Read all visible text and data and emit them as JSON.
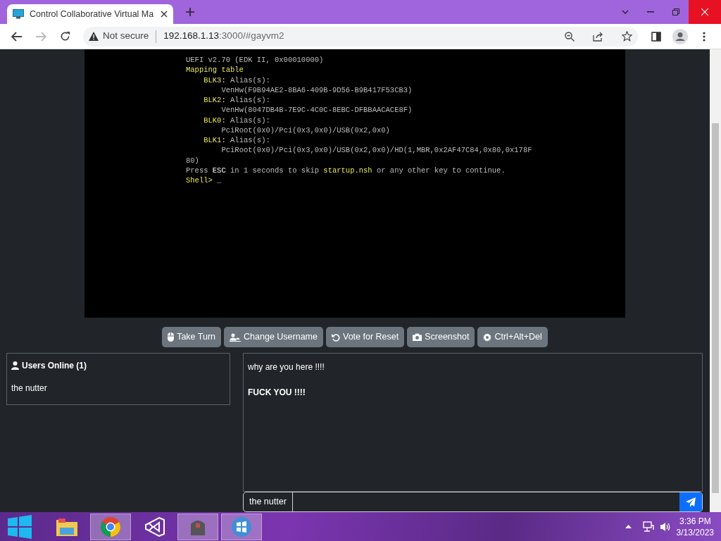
{
  "browser": {
    "tab_title": "Control Collaborative Virtual Ma",
    "security_label": "Not secure",
    "url_host": "192.168.1.13",
    "url_rest": ":3000/#gayvm2",
    "forward_disabled": true
  },
  "console": {
    "lines": [
      {
        "kind": "text",
        "segments": [
          {
            "text": "UEFI v2.70 (EDK II, 0x00010000)",
            "highlight": false
          }
        ]
      },
      {
        "kind": "text",
        "segments": [
          {
            "text": "Mapping table",
            "highlight": true
          }
        ]
      },
      {
        "kind": "alias",
        "segments": [
          {
            "text": "BLK3:",
            "highlight": true
          },
          {
            "text": " Alias(s):",
            "highlight": false
          }
        ]
      },
      {
        "kind": "path",
        "segments": [
          {
            "text": "VenHw(F9B94AE2-8BA6-409B-9D56-B9B417F53CB3)",
            "highlight": false
          }
        ]
      },
      {
        "kind": "alias",
        "segments": [
          {
            "text": "BLK2:",
            "highlight": true
          },
          {
            "text": " Alias(s):",
            "highlight": false
          }
        ]
      },
      {
        "kind": "path",
        "segments": [
          {
            "text": "VenHw(8047DB4B-7E9C-4C0C-8EBC-DFBBAACACE8F)",
            "highlight": false
          }
        ]
      },
      {
        "kind": "alias",
        "segments": [
          {
            "text": "BLK0:",
            "highlight": true
          },
          {
            "text": " Alias(s):",
            "highlight": false
          }
        ]
      },
      {
        "kind": "path",
        "segments": [
          {
            "text": "PciRoot(0x0)/Pci(0x3,0x0)/USB(0x2,0x0)",
            "highlight": false
          }
        ]
      },
      {
        "kind": "alias",
        "segments": [
          {
            "text": "BLK1:",
            "highlight": true
          },
          {
            "text": " Alias(s):",
            "highlight": false
          }
        ]
      },
      {
        "kind": "path",
        "segments": [
          {
            "text": "PciRoot(0x0)/Pci(0x3,0x0)/USB(0x2,0x0)/HD(1,MBR,0x2AF47C84,0x80,0x178F",
            "highlight": false
          }
        ]
      },
      {
        "kind": "text",
        "segments": [
          {
            "text": "80)",
            "highlight": false
          }
        ]
      },
      {
        "kind": "text",
        "segments": [
          {
            "text": "Press ",
            "highlight": false
          },
          {
            "text": "ESC",
            "highlight": false,
            "bright": true
          },
          {
            "text": " in 1 seconds to skip ",
            "highlight": false
          },
          {
            "text": "startup.nsh",
            "highlight": true
          },
          {
            "text": " or any other key to continue.",
            "highlight": false
          }
        ]
      },
      {
        "kind": "text",
        "segments": [
          {
            "text": "Shell> ",
            "highlight": true
          },
          {
            "text": "_",
            "highlight": false
          }
        ]
      }
    ]
  },
  "buttons": [
    {
      "kind": "mouse",
      "label": "Take Turn"
    },
    {
      "kind": "signature",
      "label": "Change Username"
    },
    {
      "kind": "undo",
      "label": "Vote for Reset"
    },
    {
      "kind": "camera",
      "label": "Screenshot"
    },
    {
      "kind": "gear",
      "label": "Ctrl+Alt+Del"
    }
  ],
  "users_panel": {
    "title": "Users Online (1)",
    "users": [
      "the nutter"
    ]
  },
  "chat": {
    "messages": [
      {
        "text": "why are you here !!!!",
        "bold": false
      },
      {
        "text": "FUCK YOU !!!!",
        "bold": true
      }
    ],
    "username": "the nutter"
  },
  "taskbar": {
    "apps": [
      {
        "kind": "folder",
        "selected": false
      },
      {
        "kind": "chrome",
        "selected": true
      },
      {
        "kind": "studio",
        "selected": false
      },
      {
        "kind": "app",
        "selected": true
      },
      {
        "kind": "orb",
        "selected": true
      }
    ],
    "time": "3:36 PM",
    "date": "3/13/2023"
  }
}
